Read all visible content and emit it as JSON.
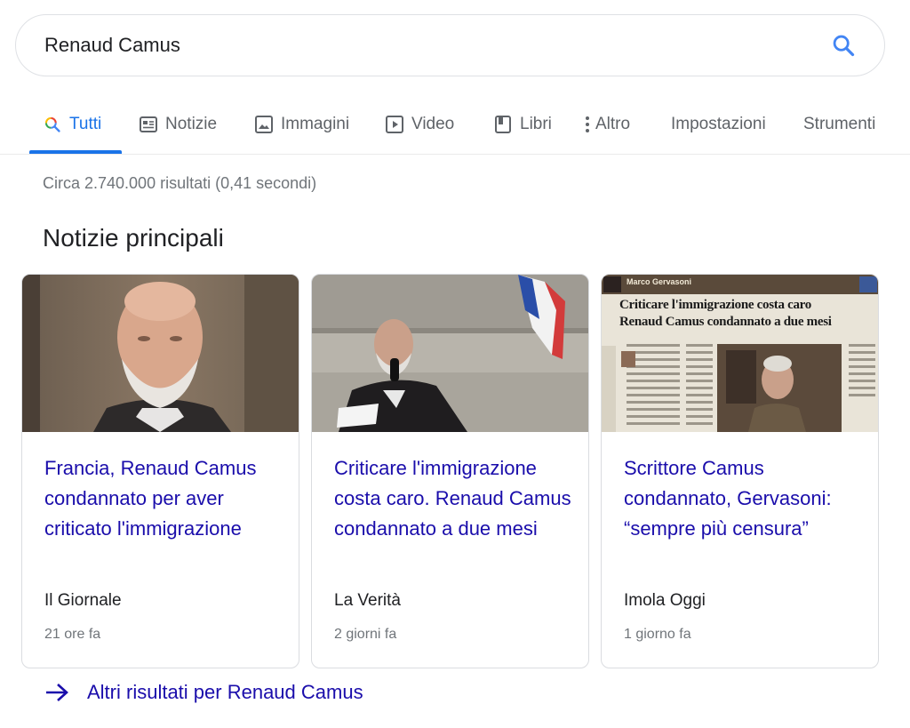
{
  "search": {
    "query": "Renaud Camus",
    "icon": "search-icon"
  },
  "tabs": [
    {
      "label": "Tutti",
      "icon": "search-icon",
      "active": true
    },
    {
      "label": "Notizie",
      "icon": "news-icon"
    },
    {
      "label": "Immagini",
      "icon": "image-icon"
    },
    {
      "label": "Video",
      "icon": "play-icon"
    },
    {
      "label": "Libri",
      "icon": "book-icon"
    },
    {
      "label": "Altro",
      "icon": "more-vert-icon"
    },
    {
      "label": "Impostazioni"
    },
    {
      "label": "Strumenti"
    }
  ],
  "stats": "Circa 2.740.000 risultati (0,41 secondi)",
  "top_stories": {
    "title": "Notizie principali",
    "cards": [
      {
        "title": "Francia, Renaud Camus condannato per aver criticato l'immigrazione",
        "source": "Il Giornale",
        "time": "21 ore fa"
      },
      {
        "title": "Criticare l'immigrazione costa caro. Renaud Camus condannato a due mesi",
        "source": "La Verità",
        "time": "2 giorni fa"
      },
      {
        "title": "Scrittore Camus condannato, Gervasoni: “sempre più censura”",
        "source": "Imola Oggi",
        "time": "1 giorno fa"
      }
    ],
    "image3_text": {
      "byline": "Marco Gervasoni",
      "headline_1": "Criticare l'immigrazione costa caro",
      "headline_2": "Renaud Camus condannato a due mesi"
    }
  },
  "more_link": "Altri risultati per Renaud Camus",
  "colors": {
    "accent": "#1a73e8",
    "link": "#1a0dab",
    "muted": "#70757a"
  }
}
